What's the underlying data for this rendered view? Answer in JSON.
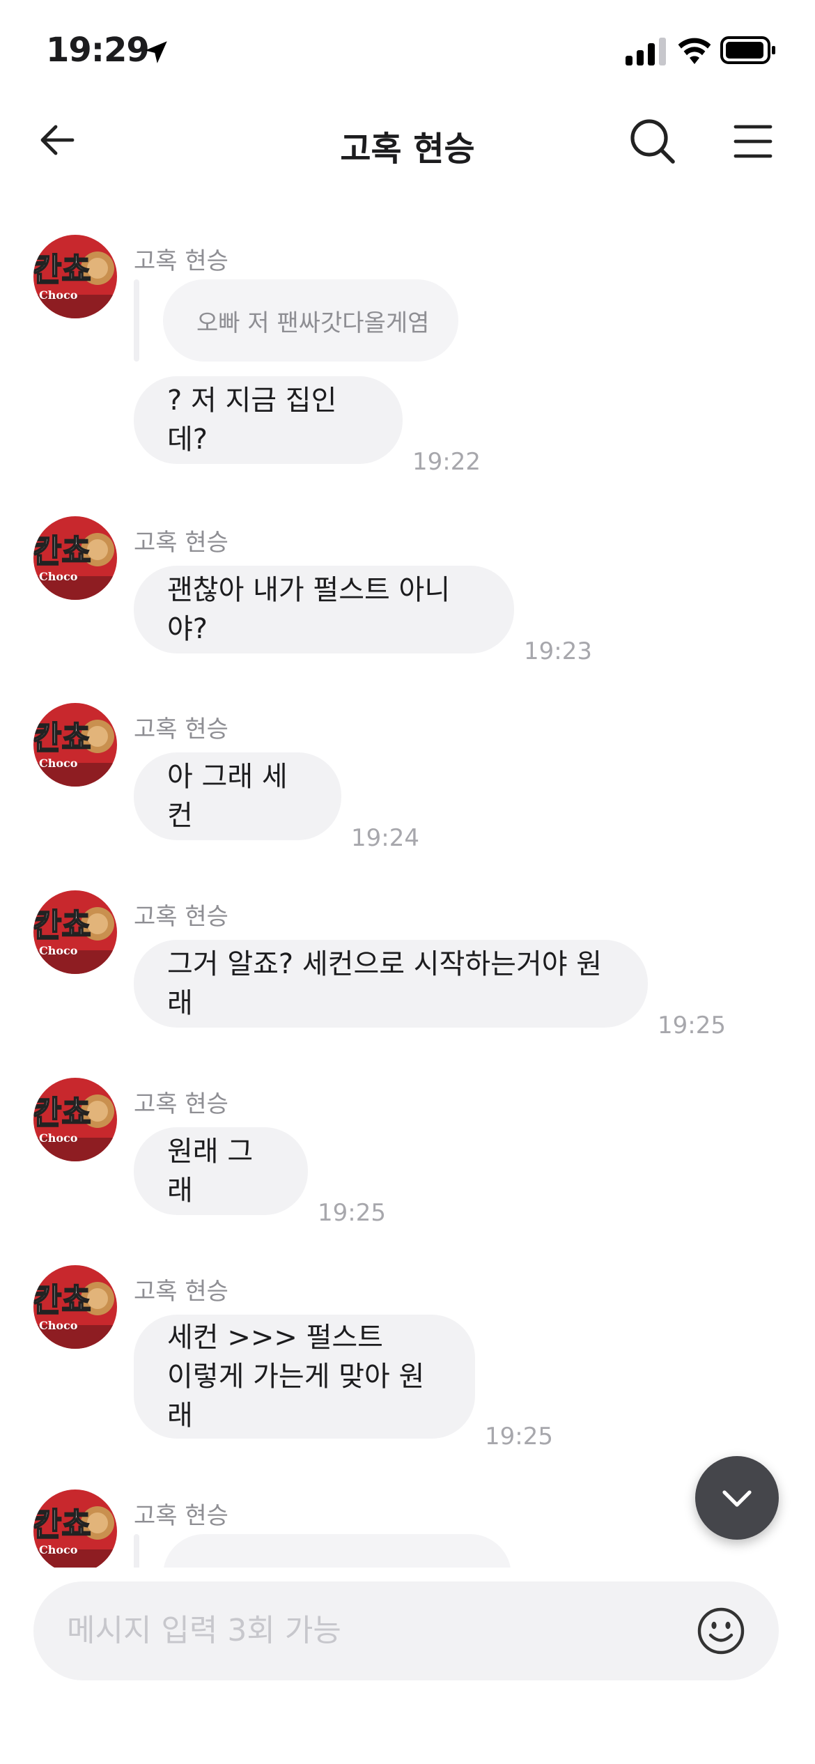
{
  "status_bar": {
    "time": "19:29"
  },
  "header": {
    "title": "고혹 현승"
  },
  "messages": [
    {
      "sender": "고혹 현승",
      "quote": "오빠 저 팬싸갓다올게염",
      "text": "? 저 지금 집인데?",
      "time": "19:22"
    },
    {
      "sender": "고혹 현승",
      "text": "괜찮아 내가 펄스트 아니야?",
      "time": "19:23"
    },
    {
      "sender": "고혹 현승",
      "text": "아 그래 세컨",
      "time": "19:24"
    },
    {
      "sender": "고혹 현승",
      "text": "그거 알죠? 세컨으로 시작하는거야 원래",
      "time": "19:25"
    },
    {
      "sender": "고혹 현승",
      "text": "원래 그래",
      "time": "19:25"
    },
    {
      "sender": "고혹 현승",
      "text": "세컨 >>> 펄스트\n이렇게 가는게 맞아 원래",
      "time": "19:25"
    },
    {
      "sender": "고혹 현승"
    }
  ],
  "input": {
    "placeholder": "메시지 입력 3회 가능"
  },
  "colors": {
    "bubble": "#f2f2f4",
    "fab": "#45464b",
    "avatar_red": "#c8282d"
  }
}
